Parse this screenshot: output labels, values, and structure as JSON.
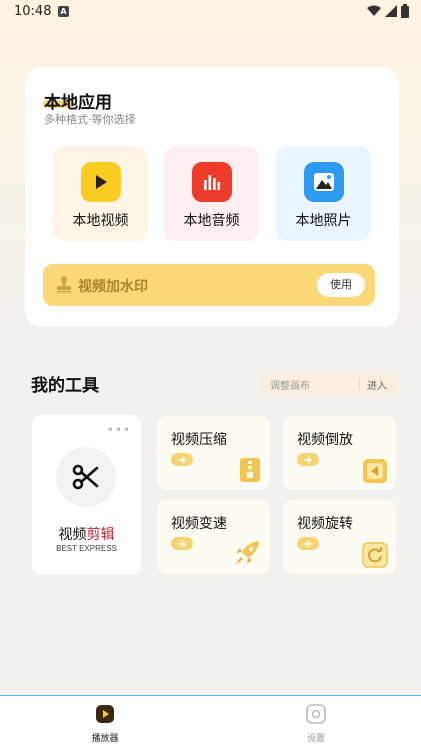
{
  "status": {
    "time": "10:48",
    "notif": "A"
  },
  "local_apps": {
    "title": "本地应用",
    "subtitle": "多种格式·等你选择",
    "items": [
      {
        "label": "本地视频",
        "icon": "play-icon",
        "bg": "#fdf6e6",
        "icon_color": "#fbcd22"
      },
      {
        "label": "本地音频",
        "icon": "audio-bars-icon",
        "bg": "#fdeef0",
        "icon_color": "#ef3b2a"
      },
      {
        "label": "本地照片",
        "icon": "photo-icon",
        "bg": "#eaf5fd",
        "icon_color": "#2d9bf0"
      }
    ],
    "watermark": {
      "label": "视频加水印",
      "button": "使用"
    }
  },
  "tools": {
    "title": "我的工具",
    "search_placeholder": "调整画布",
    "search_go": "进入",
    "featured": {
      "name_a": "视频",
      "name_b": "剪辑",
      "sub": "BEST EXPRESS",
      "dots": "•••"
    },
    "items": [
      {
        "label": "视频压缩",
        "icon": "zip-file-icon"
      },
      {
        "label": "视频倒放",
        "icon": "rewind-icon"
      },
      {
        "label": "视频变速",
        "icon": "rocket-icon"
      },
      {
        "label": "视频旋转",
        "icon": "rotate-icon"
      }
    ]
  },
  "tabbar": {
    "tabs": [
      {
        "label": "播放器",
        "active": true
      },
      {
        "label": "设置",
        "active": false
      }
    ]
  },
  "colors": {
    "accent": "#fad877",
    "accent_text": "#a6852e",
    "brand_red": "#c8202f"
  }
}
